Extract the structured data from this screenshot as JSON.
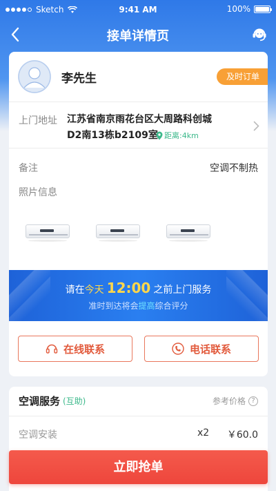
{
  "status_bar": {
    "carrier": "Sketch",
    "time": "9:41 AM",
    "battery": "100%"
  },
  "nav": {
    "title": "接单详情页",
    "back_icon": "chevron-left-icon",
    "service_icon": "customer-service-icon"
  },
  "order": {
    "customer_name": "李先生",
    "tag": "及时订单",
    "address_label": "上门地址",
    "address_line1": "江苏省南京雨花台区大周路科创城",
    "address_line2": "D2南13栋b2109室",
    "distance": "距离:4km",
    "note_label": "备注",
    "note_value": "空调不制热",
    "photos_label": "照片信息",
    "photos": [
      "air-conditioner-photo",
      "air-conditioner-photo",
      "air-conditioner-photo"
    ]
  },
  "banner": {
    "prefix": "请在",
    "day": "今天",
    "time": "12:00",
    "suffix": "之前上门服务",
    "sub_prefix": "准时到达将会",
    "sub_highlight": "提高",
    "sub_suffix": "综合评分"
  },
  "contact": {
    "online_label": "在线联系",
    "phone_label": "电话联系"
  },
  "service": {
    "title": "空调服务",
    "tag": "(互助)",
    "ref_price_label": "参考价格",
    "items": [
      {
        "name": "空调安装",
        "qty": "x2",
        "price": "￥60.0"
      }
    ]
  },
  "cta": {
    "label": "立即抢单"
  },
  "colors": {
    "primary_blue": "#2f79e8",
    "order_tag": "#f8a036",
    "accent_red": "#ee463c",
    "distance_green": "#3bb88a",
    "highlight_yellow": "#ffd74a"
  }
}
